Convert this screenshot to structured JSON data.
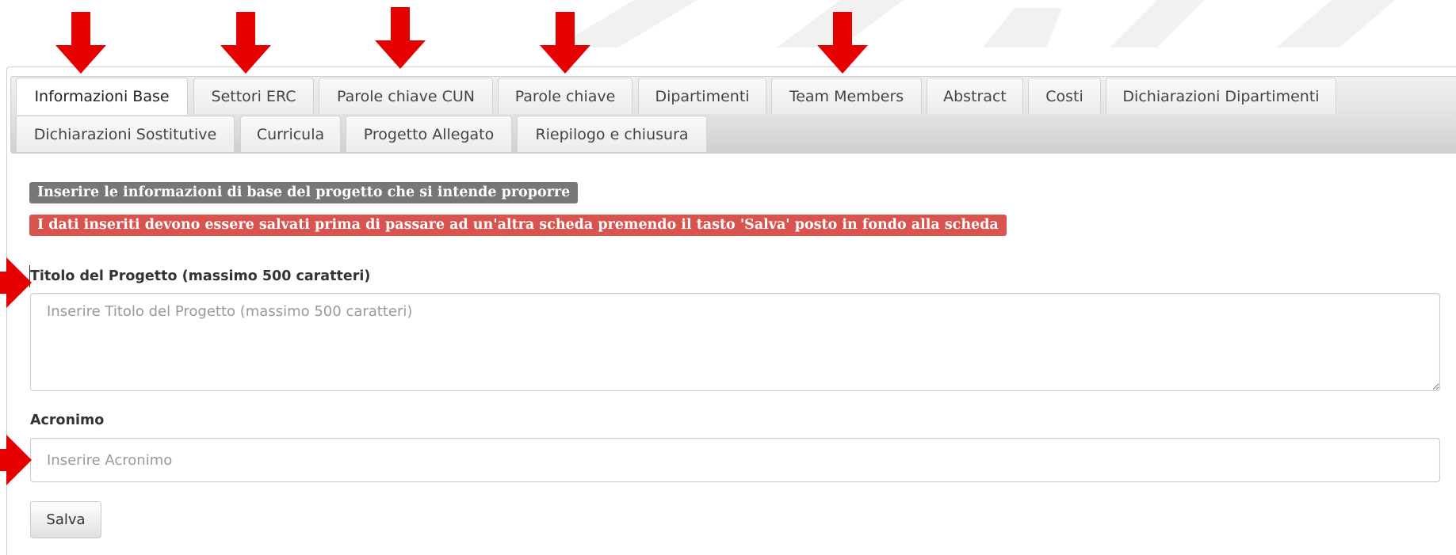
{
  "tabs": {
    "row1": [
      {
        "label": "Informazioni Base",
        "active": true
      },
      {
        "label": "Settori ERC"
      },
      {
        "label": "Parole chiave CUN"
      },
      {
        "label": "Parole chiave"
      },
      {
        "label": "Dipartimenti"
      },
      {
        "label": "Team Members"
      },
      {
        "label": "Abstract"
      },
      {
        "label": "Costi"
      },
      {
        "label": "Dichiarazioni Dipartimenti"
      }
    ],
    "row2": [
      {
        "label": "Dichiarazioni Sostitutive"
      },
      {
        "label": "Curricula"
      },
      {
        "label": "Progetto Allegato"
      },
      {
        "label": "Riepilogo e chiusura"
      }
    ]
  },
  "notices": {
    "info": "Inserire le informazioni di base del progetto che si intende proporre",
    "warning": "I dati inseriti devono essere salvati prima di passare ad un'altra scheda premendo il tasto 'Salva' posto in fondo alla scheda"
  },
  "form": {
    "title_label": "Titolo del Progetto (massimo 500 caratteri)",
    "title_placeholder": "Inserire Titolo del Progetto (massimo 500 caratteri)",
    "title_value": "",
    "acronym_label": "Acronimo",
    "acronym_placeholder": "Inserire Acronimo",
    "acronym_value": "",
    "save_label": "Salva"
  },
  "annotations": {
    "arrow_color": "#e60000",
    "arrow_icon": "red-arrow-icon"
  },
  "colors": {
    "info_badge": "#777777",
    "danger_badge": "#d9534f"
  }
}
